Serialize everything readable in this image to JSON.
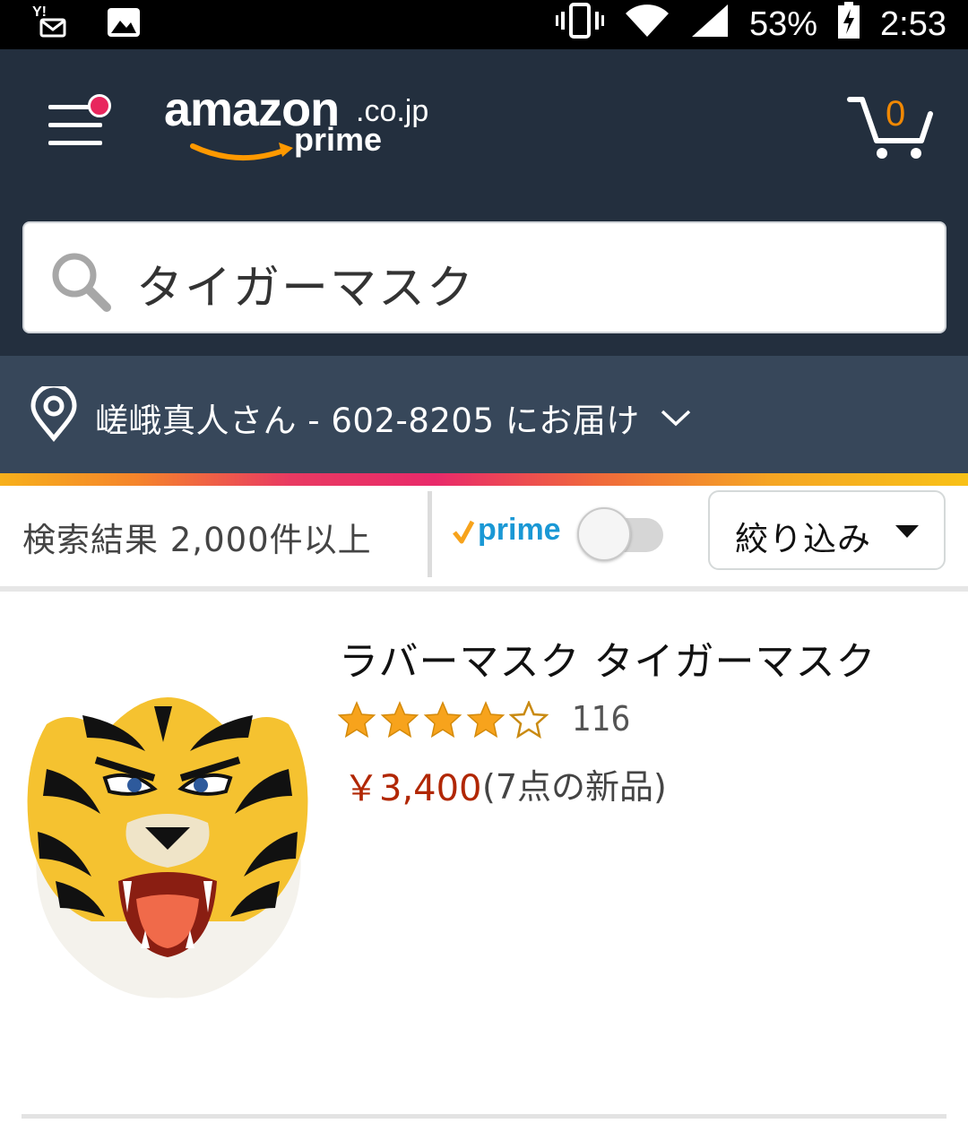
{
  "status_bar": {
    "battery": "53%",
    "time": "2:53",
    "left_icons": [
      "yahoo-mail-icon",
      "image-icon"
    ],
    "right_icons": [
      "vibrate-icon",
      "wifi-icon",
      "signal-icon",
      "battery-charging-icon"
    ]
  },
  "header": {
    "logo_main": "amazon",
    "logo_domain": ".co.jp",
    "logo_sub": "prime",
    "cart_count": "0"
  },
  "search": {
    "query": "タイガーマスク"
  },
  "delivery": {
    "text": "嵯峨真人さん - 602-8205 にお届け"
  },
  "filter_bar": {
    "results_text": "検索結果 2,000件以上",
    "prime_label": "prime",
    "prime_toggle_on": false,
    "filter_button": "絞り込み"
  },
  "product": {
    "title": "ラバーマスク タイガーマスク",
    "rating": 4,
    "rating_max": 5,
    "review_count": "116",
    "price": "￥3,400",
    "offers": "(7点の新品)"
  },
  "colors": {
    "header_bg": "#232f3e",
    "delivery_bg": "#37475a",
    "price": "#b12704",
    "star": "#f7a31c",
    "accent_orange": "#f08804"
  }
}
